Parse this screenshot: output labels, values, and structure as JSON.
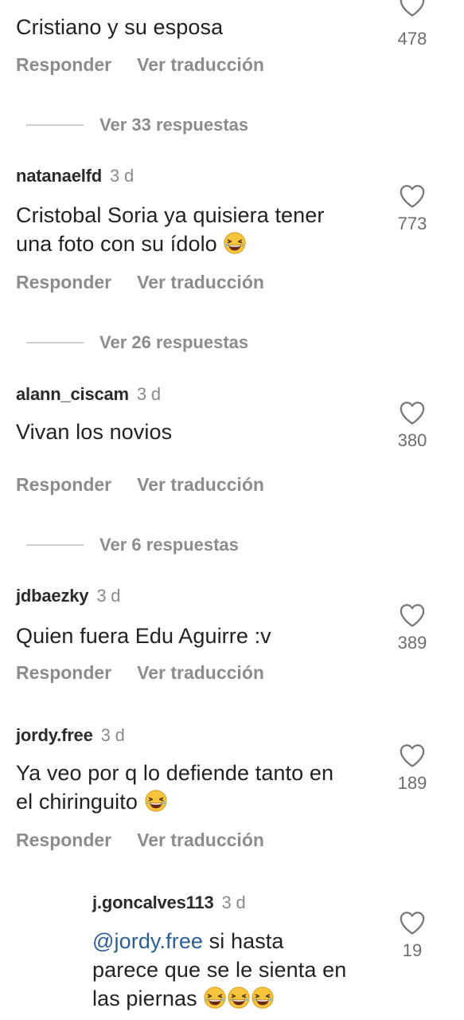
{
  "comments": [
    {
      "user": "",
      "time": "",
      "text": "Cristiano y su esposa",
      "likes": "478",
      "reply": "Responder",
      "translate": "Ver traducción",
      "view_replies": "Ver 33 respuestas"
    },
    {
      "user": "natanaelfd",
      "time": "3 d",
      "text_1": "Cristobal Soria ya quisiera tener",
      "text_2": "una foto con su ídolo",
      "likes": "773",
      "reply": "Responder",
      "translate": "Ver traducción",
      "view_replies": "Ver 26 respuestas"
    },
    {
      "user": "alann_ciscam",
      "time": "3 d",
      "text": "Vivan los novios",
      "likes": "380",
      "reply": "Responder",
      "translate": "Ver traducción",
      "view_replies": "Ver 6 respuestas"
    },
    {
      "user": "jdbaezky",
      "time": "3 d",
      "text": "Quien fuera Edu Aguirre :v",
      "likes": "389",
      "reply": "Responder",
      "translate": "Ver traducción"
    },
    {
      "user": "jordy.free",
      "time": "3 d",
      "text_1": "Ya veo por q lo defiende tanto en",
      "text_2": "el chiringuito",
      "likes": "189",
      "reply": "Responder",
      "translate": "Ver traducción"
    }
  ],
  "reply": {
    "user": "j.goncalves113",
    "time": "3 d",
    "mention": "@jordy.free",
    "text_1": "si hasta",
    "text_2": "parece que se le sienta en",
    "text_3": "las piernas",
    "likes": "19"
  },
  "icons": {
    "like": "heart-outline-icon",
    "emoji": "grinning-squinting-face-emoji"
  },
  "colors": {
    "mention": "#2b5f96",
    "muted": "#8c8c8c",
    "text": "#222222"
  }
}
